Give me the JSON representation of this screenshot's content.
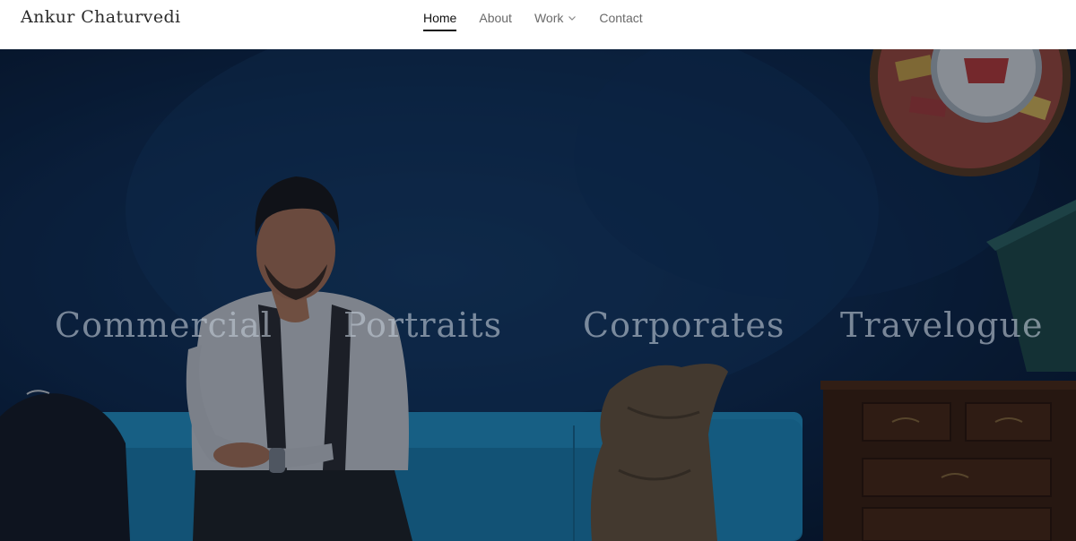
{
  "brand": {
    "name": "Ankur Chaturvedi"
  },
  "nav": {
    "items": [
      {
        "label": "Home",
        "active": true
      },
      {
        "label": "About"
      },
      {
        "label": "Work",
        "has_dropdown": true
      },
      {
        "label": "Contact"
      }
    ]
  },
  "hero": {
    "categories": [
      "Commercial",
      "Portraits",
      "Corporates",
      "Travelogue"
    ]
  },
  "colors": {
    "wall": "#0d2b52",
    "sofa": "#1e8fc4",
    "nav_active": "#111111",
    "nav_text": "#6a6a6a"
  }
}
